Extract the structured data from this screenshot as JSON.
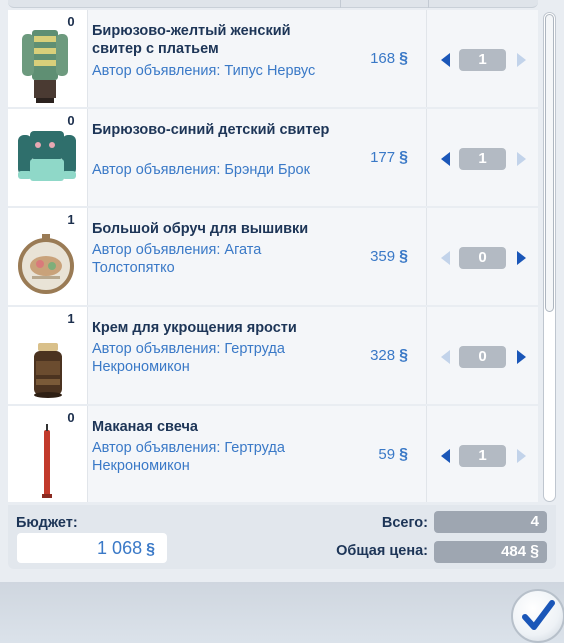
{
  "items": [
    {
      "badge": "0",
      "title": "Бирюзово-желтый женский свитер с платьем",
      "author": "Автор объявления: Типус Нервус",
      "price": "168",
      "quantity": "1",
      "icon": "sweater-dress-icon"
    },
    {
      "badge": "0",
      "title": "Бирюзово-синий детский свитер",
      "author": "Автор объявления: Брэнди Брок",
      "price": "177",
      "quantity": "1",
      "icon": "kids-sweater-icon"
    },
    {
      "badge": "1",
      "title": "Большой обруч для вышивки",
      "author": "Автор объявления: Агата Толстопятко",
      "price": "359",
      "quantity": "0",
      "icon": "embroidery-hoop-icon"
    },
    {
      "badge": "1",
      "title": "Крем для укрощения ярости",
      "author": "Автор объявления: Гертруда Некрономикон",
      "price": "328",
      "quantity": "0",
      "icon": "cream-jar-icon"
    },
    {
      "badge": "0",
      "title": "Маканая свеча",
      "author": "Автор объявления: Гертруда Некрономикон",
      "price": "59",
      "quantity": "1",
      "icon": "candle-icon"
    }
  ],
  "currency_symbol": "§",
  "footer": {
    "budget_label": "Бюджет:",
    "budget_value": "1 068",
    "total_label": "Всего:",
    "total_value": "4",
    "price_label": "Общая цена:",
    "price_value": "484"
  },
  "colors": {
    "accent": "#3a79c7",
    "title": "#1d3557",
    "arrow_active": "#1a56b8",
    "arrow_disabled": "#c2d3ea"
  }
}
